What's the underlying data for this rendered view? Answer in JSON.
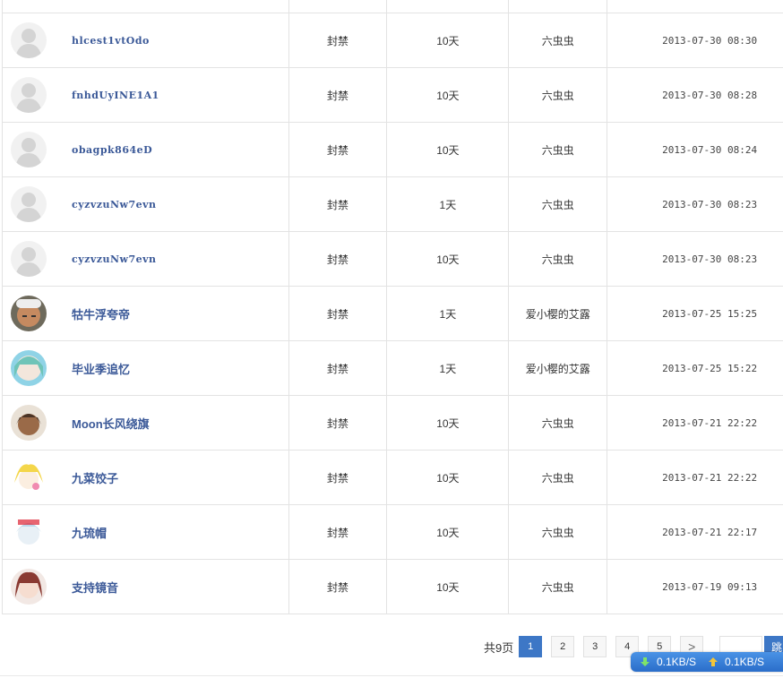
{
  "rows": [
    {
      "username": "hlcest1vtOdo",
      "status": "封禁",
      "duration": "10天",
      "operator": "六虫虫",
      "time": "2013-07-30 08:30",
      "avatar": "default"
    },
    {
      "username": "fnhdUyINE1A1",
      "status": "封禁",
      "duration": "10天",
      "operator": "六虫虫",
      "time": "2013-07-30 08:28",
      "avatar": "default"
    },
    {
      "username": "obagpk864eD",
      "status": "封禁",
      "duration": "10天",
      "operator": "六虫虫",
      "time": "2013-07-30 08:24",
      "avatar": "default"
    },
    {
      "username": "cyzvzuNw7evn",
      "status": "封禁",
      "duration": "1天",
      "operator": "六虫虫",
      "time": "2013-07-30 08:23",
      "avatar": "default"
    },
    {
      "username": "cyzvzuNw7evn",
      "status": "封禁",
      "duration": "10天",
      "operator": "六虫虫",
      "time": "2013-07-30 08:23",
      "avatar": "default"
    },
    {
      "username": "牯牛浮夸帝",
      "status": "封禁",
      "duration": "1天",
      "operator": "爱小樱的艾露",
      "time": "2013-07-25 15:25",
      "avatar": "photo-man"
    },
    {
      "username": "毕业季追忆",
      "status": "封禁",
      "duration": "1天",
      "operator": "爱小樱的艾露",
      "time": "2013-07-25 15:22",
      "avatar": "anime-teal"
    },
    {
      "username": "Moon长风绕旗",
      "status": "封禁",
      "duration": "10天",
      "operator": "六虫虫",
      "time": "2013-07-21 22:22",
      "avatar": "anime-brown"
    },
    {
      "username": "九菜饺子",
      "status": "封禁",
      "duration": "10天",
      "operator": "六虫虫",
      "time": "2013-07-21 22:22",
      "avatar": "anime-yellow"
    },
    {
      "username": "九琉帽",
      "status": "封禁",
      "duration": "10天",
      "operator": "六虫虫",
      "time": "2013-07-21 22:17",
      "avatar": "anime-white"
    },
    {
      "username": "支持镜音",
      "status": "封禁",
      "duration": "10天",
      "operator": "六虫虫",
      "time": "2013-07-19 09:13",
      "avatar": "anime-red"
    }
  ],
  "pagination": {
    "total_label": "共9页",
    "pages": [
      "1",
      "2",
      "3",
      "4",
      "5"
    ],
    "current": "1",
    "next_label": ">",
    "go_label": "跳"
  },
  "speed_widget": {
    "down": "0.1KB/S",
    "up": "0.1KB/S"
  },
  "colors": {
    "link": "#3b5998",
    "accent": "#3d77c6",
    "border": "#e3e3e3"
  }
}
